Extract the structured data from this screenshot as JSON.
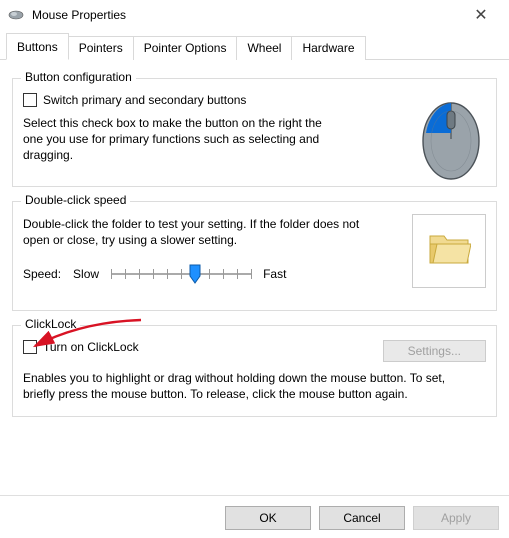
{
  "window": {
    "title": "Mouse Properties",
    "close_glyph": "✕"
  },
  "tabs": [
    "Buttons",
    "Pointers",
    "Pointer Options",
    "Wheel",
    "Hardware"
  ],
  "active_tab": "Buttons",
  "group_button_config": {
    "legend": "Button configuration",
    "checkbox_label": "Switch primary and secondary buttons",
    "checkbox_checked": false,
    "description": "Select this check box to make the button on the right the one you use for primary functions such as selecting and dragging."
  },
  "group_double_click": {
    "legend": "Double-click speed",
    "description": "Double-click the folder to test your setting. If the folder does not open or close, try using a slower setting.",
    "speed_label": "Speed:",
    "slow_label": "Slow",
    "fast_label": "Fast",
    "slider_value": 6,
    "slider_min": 0,
    "slider_max": 10
  },
  "group_clicklock": {
    "legend": "ClickLock",
    "checkbox_label": "Turn on ClickLock",
    "checkbox_checked": false,
    "settings_button": "Settings...",
    "settings_enabled": false,
    "description": "Enables you to highlight or drag without holding down the mouse button. To set, briefly press the mouse button. To release, click the mouse button again."
  },
  "buttons": {
    "ok": "OK",
    "cancel": "Cancel",
    "apply": "Apply",
    "apply_enabled": false
  },
  "icons": {
    "mouse_title": "mouse-icon",
    "folder": "folder-icon"
  }
}
